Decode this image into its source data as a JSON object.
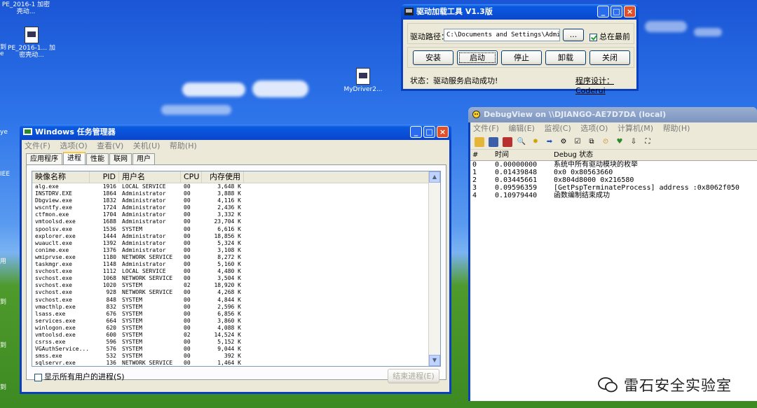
{
  "desktop": {
    "icons": [
      {
        "label": "PE_2016-1 加密壳动..."
      },
      {
        "label": "PE_2016-1... 加密壳动..."
      },
      {
        "label": "MyDriver2..."
      }
    ],
    "edge_texts": [
      "到",
      "e",
      "ye",
      "IEE",
      "用",
      "到",
      "到",
      "到"
    ]
  },
  "loader": {
    "title": "驱动加载工具 V1.3版",
    "path_label": "驱动路径：",
    "path_value": "C:\\Documents and Settings\\Administ",
    "browse": "...",
    "topmost": "总在最前",
    "buttons": [
      "安装",
      "启动",
      "停止",
      "卸载",
      "关闭"
    ],
    "status": "状态：驱动服务启动成功!",
    "credit": "程序设计：Coderui"
  },
  "taskmgr": {
    "title": "Windows 任务管理器",
    "menu": [
      "文件(F)",
      "选项(O)",
      "查看(V)",
      "关机(U)",
      "帮助(H)"
    ],
    "tabs": [
      "应用程序",
      "进程",
      "性能",
      "联网",
      "用户"
    ],
    "columns": [
      "映像名称",
      "PID",
      "用户名",
      "CPU",
      "内存使用"
    ],
    "rows": [
      [
        "alg.exe",
        "1916",
        "LOCAL SERVICE",
        "00",
        "3,648 K"
      ],
      [
        "INSTDRV.EXE",
        "1864",
        "Administrator",
        "00",
        "3,888 K"
      ],
      [
        "Dbgview.exe",
        "1832",
        "Administrator",
        "00",
        "4,116 K"
      ],
      [
        "wscntfy.exe",
        "1724",
        "Administrator",
        "00",
        "2,436 K"
      ],
      [
        "ctfmon.exe",
        "1704",
        "Administrator",
        "00",
        "3,332 K"
      ],
      [
        "vmtoolsd.exe",
        "1688",
        "Administrator",
        "00",
        "23,704 K"
      ],
      [
        "spoolsv.exe",
        "1536",
        "SYSTEM",
        "00",
        "6,616 K"
      ],
      [
        "explorer.exe",
        "1444",
        "Administrator",
        "00",
        "18,856 K"
      ],
      [
        "wuauclt.exe",
        "1392",
        "Administrator",
        "00",
        "5,324 K"
      ],
      [
        "conime.exe",
        "1376",
        "Administrator",
        "00",
        "3,108 K"
      ],
      [
        "wmiprvse.exe",
        "1180",
        "NETWORK SERVICE",
        "00",
        "8,272 K"
      ],
      [
        "taskmgr.exe",
        "1148",
        "Administrator",
        "00",
        "5,160 K"
      ],
      [
        "svchost.exe",
        "1112",
        "LOCAL SERVICE",
        "00",
        "4,480 K"
      ],
      [
        "svchost.exe",
        "1068",
        "NETWORK SERVICE",
        "00",
        "3,504 K"
      ],
      [
        "svchost.exe",
        "1020",
        "SYSTEM",
        "02",
        "18,920 K"
      ],
      [
        "svchost.exe",
        "928",
        "NETWORK SERVICE",
        "00",
        "4,268 K"
      ],
      [
        "svchost.exe",
        "848",
        "SYSTEM",
        "00",
        "4,844 K"
      ],
      [
        "vmacthlp.exe",
        "832",
        "SYSTEM",
        "00",
        "2,596 K"
      ],
      [
        "lsass.exe",
        "676",
        "SYSTEM",
        "00",
        "6,856 K"
      ],
      [
        "services.exe",
        "664",
        "SYSTEM",
        "00",
        "3,860 K"
      ],
      [
        "winlogon.exe",
        "620",
        "SYSTEM",
        "00",
        "4,088 K"
      ],
      [
        "vmtoolsd.exe",
        "600",
        "SYSTEM",
        "02",
        "14,524 K"
      ],
      [
        "csrss.exe",
        "596",
        "SYSTEM",
        "00",
        "5,152 K"
      ],
      [
        "VGAuthService...",
        "576",
        "SYSTEM",
        "00",
        "9,044 K"
      ],
      [
        "smss.exe",
        "532",
        "SYSTEM",
        "00",
        "392 K"
      ],
      [
        "sqlservr.exe",
        "136",
        "NETWORK SERVICE",
        "00",
        "1,464 K"
      ]
    ],
    "show_all": "显示所有用户的进程(S)",
    "end_process": "结束进程(E)"
  },
  "dbgview": {
    "title": "DebugView on \\\\DJIANGO-AE7D7DA (local)",
    "menu": [
      "文件(F)",
      "编辑(E)",
      "监视(C)",
      "选项(O)",
      "计算机(M)",
      "帮助(H)"
    ],
    "columns": [
      "#",
      "时间",
      "Debug 状态"
    ],
    "rows": [
      [
        "0",
        "0.00000000",
        "系统中所有驱动模块的枚举"
      ],
      [
        "1",
        "0.01439848",
        "0x0 0x80563660"
      ],
      [
        "2",
        "0.03445661",
        "0x804d8000 0x216580"
      ],
      [
        "3",
        "0.09596359",
        "[GetPspTerminateProcess] address :0x8062f050"
      ],
      [
        "4",
        "0.10979440",
        "函数编制结束成功"
      ]
    ]
  },
  "watermark": "雷石安全实验室"
}
